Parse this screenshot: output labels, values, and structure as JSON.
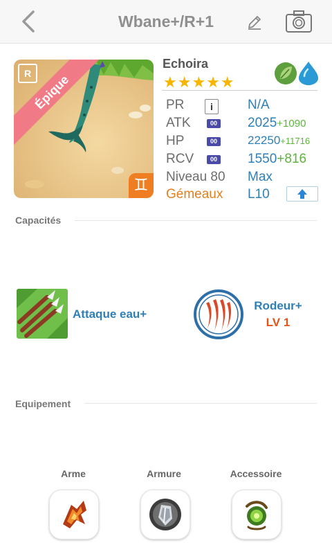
{
  "header": {
    "title": "Wbane+/R+1",
    "back_icon": "chevron-left-icon",
    "edit_icon": "pencil-icon",
    "camera_icon": "camera-icon"
  },
  "monster": {
    "name": "Echoira",
    "rarity_label": "Épique",
    "rarity_badge": "R",
    "zodiac_glyph": "♊",
    "stars": "★★★★★",
    "star_count": 5,
    "elements": [
      "leaf-element-icon",
      "water-element-icon"
    ]
  },
  "stats": {
    "pr": {
      "label": "PR",
      "badge": "i",
      "value": "N/A"
    },
    "atk": {
      "label": "ATK",
      "badge": "00",
      "value": "2025",
      "plus": "+1090"
    },
    "hp": {
      "label": "HP",
      "badge": "00",
      "value": "22250",
      "plus": "+11716"
    },
    "rcv": {
      "label": "RCV",
      "badge": "00",
      "value": "1550",
      "plus": "+816"
    },
    "level": {
      "label": "Niveau 80",
      "value": "Max"
    },
    "zodiac": {
      "label": "Gémeaux",
      "value": "L10"
    }
  },
  "sections": {
    "abilities": "Capacités",
    "equipment": "Equipement"
  },
  "abilities": [
    {
      "name": "Attaque eau+"
    },
    {
      "name": "Rodeur+",
      "level": "LV 1"
    }
  ],
  "equipment": [
    {
      "label": "Arme",
      "icon": "weapon-icon"
    },
    {
      "label": "Armure",
      "icon": "armor-icon"
    },
    {
      "label": "Accessoire",
      "icon": "accessory-icon"
    }
  ],
  "colors": {
    "accent_blue": "#2e7fb8",
    "bonus_green": "#5bb53a",
    "zodiac_orange": "#e0801e",
    "epic_ribbon": "#f07a86"
  }
}
